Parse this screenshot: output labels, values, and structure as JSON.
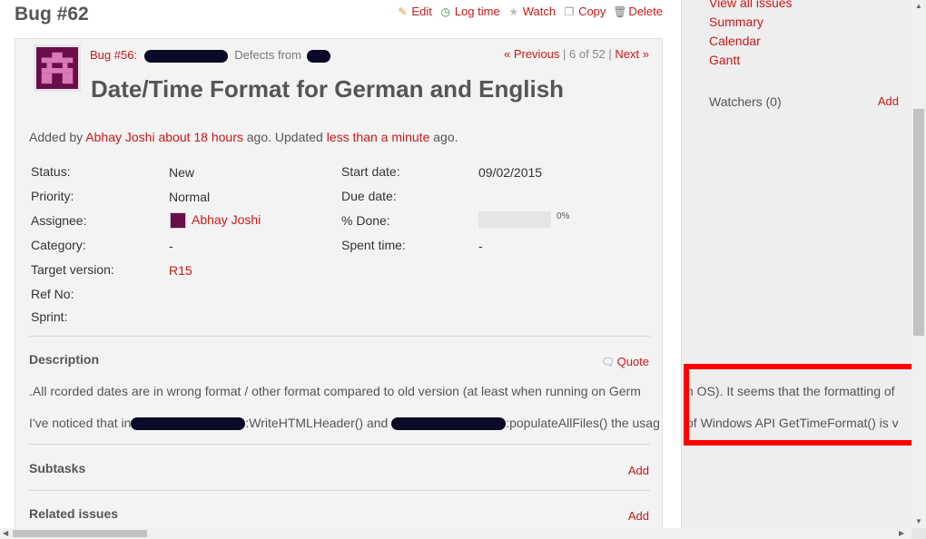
{
  "page": {
    "title": "Bug #62"
  },
  "actions": {
    "edit": "Edit",
    "log_time": "Log time",
    "watch": "Watch",
    "copy": "Copy",
    "delete": "Delete"
  },
  "issue": {
    "parent_link": "Bug #56:",
    "parent_suffix": "Defects from",
    "nav": {
      "previous": "« Previous",
      "position": "6 of 52",
      "next": "Next »"
    },
    "subject": "Date/Time Format for German and English",
    "author_prefix": "Added by",
    "author": "Abhay Joshi",
    "added_ago": "about 18 hours",
    "ago1": "ago. Updated",
    "updated_ago": "less than a minute",
    "ago2": "ago."
  },
  "attributes": {
    "status_label": "Status:",
    "status": "New",
    "priority_label": "Priority:",
    "priority": "Normal",
    "assignee_label": "Assignee:",
    "assignee": "Abhay Joshi",
    "category_label": "Category:",
    "category": "-",
    "target_label": "Target version:",
    "target": "R15",
    "refno_label": "Ref No:",
    "sprint_label": "Sprint:",
    "start_label": "Start date:",
    "start": "09/02/2015",
    "due_label": "Due date:",
    "done_label": "% Done:",
    "done": "0%",
    "done_fraction": 0,
    "spent_label": "Spent time:",
    "spent": "-"
  },
  "description": {
    "title": "Description",
    "quote": "Quote",
    "line1": ".All rcorded dates are in wrong format / other format compared to old version (at least when running on Germ",
    "line1_overflow": "n OS). It seems that the formatting of",
    "line2_a": "I've noticed that in",
    "line2_b": ":WriteHTMLHeader() and",
    "line2_c": ":populateAllFiles() the usag",
    "line2_overflow": "of Windows API GetTimeFormat() is v"
  },
  "subtasks": {
    "title": "Subtasks",
    "add": "Add"
  },
  "related": {
    "title": "Related issues",
    "add": "Add"
  },
  "sidebar": {
    "links": [
      "View all issues",
      "Summary",
      "Calendar",
      "Gantt"
    ],
    "watchers": "Watchers (0)",
    "watchers_add": "Add"
  },
  "colors": {
    "link": "#c61a1a",
    "highlight": "#ff0000",
    "avatar": "#6a0e4a"
  }
}
